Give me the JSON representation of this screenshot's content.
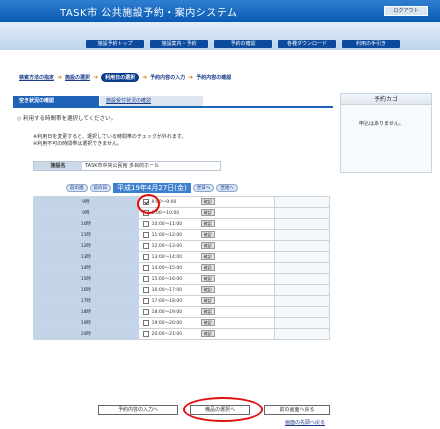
{
  "header": {
    "title": "TASK市 公共施設予約・案内システム",
    "logout": "ログアウト"
  },
  "nav": {
    "tabs": [
      "施設予約トップ",
      "施設案内・予約",
      "予約の確認",
      "各種ダウンロード",
      "利用の手引き"
    ]
  },
  "breadcrumb": {
    "items": [
      "検索方法の指定",
      "施設の選択",
      "利用日の選択",
      "予約内容の入力",
      "予約内容の確認"
    ],
    "current_index": 2
  },
  "panel_tabs": {
    "active": "空き状況の確認",
    "inactive": "施設受付状況の確認"
  },
  "cart": {
    "title": "予約カゴ",
    "message": "申込はありません。"
  },
  "section_title": "◇ 利用する時間帯を選択してください。",
  "notes": [
    "※利用日を変更すると、選択している時間帯のチェックが外れます。",
    "※利用不可の時間帯は選択できません。"
  ],
  "facility": {
    "label": "施設名",
    "value": "TASK市中央公民館 多目的ホール"
  },
  "date_nav": {
    "prev_week": "前の週",
    "prev_day": "前の日",
    "date": "平成19年4月27日(金)",
    "next_day": "翌日へ",
    "next_week": "翌週へ"
  },
  "slots": [
    {
      "time": "9時",
      "label": "9:00～9:00",
      "checked": true
    },
    {
      "time": "9時",
      "label": "9:00～10:00",
      "checked": false
    },
    {
      "time": "10時",
      "label": "10:00～11:00",
      "checked": false
    },
    {
      "time": "11時",
      "label": "11:00～12:00",
      "checked": false
    },
    {
      "time": "12時",
      "label": "12:00～13:00",
      "checked": false
    },
    {
      "time": "13時",
      "label": "13:00～14:00",
      "checked": false
    },
    {
      "time": "14時",
      "label": "14:00～15:00",
      "checked": false
    },
    {
      "time": "15時",
      "label": "15:00～16:00",
      "checked": false
    },
    {
      "time": "16時",
      "label": "16:00～17:00",
      "checked": false
    },
    {
      "time": "17時",
      "label": "17:00～18:00",
      "checked": false
    },
    {
      "time": "18時",
      "label": "18:00～19:00",
      "checked": false
    },
    {
      "time": "19時",
      "label": "19:00～20:00",
      "checked": false
    },
    {
      "time": "20時",
      "label": "20:00～21:00",
      "checked": false
    }
  ],
  "confirm_label": "確認",
  "buttons": {
    "back": "予約内容の入力へ",
    "next": "備品の選択へ",
    "prev_page": "前の画面へ戻る"
  },
  "top_link": "画面の先頭へ戻る",
  "colors": {
    "accent": "#1f63b8",
    "highlight": "#e01010"
  }
}
